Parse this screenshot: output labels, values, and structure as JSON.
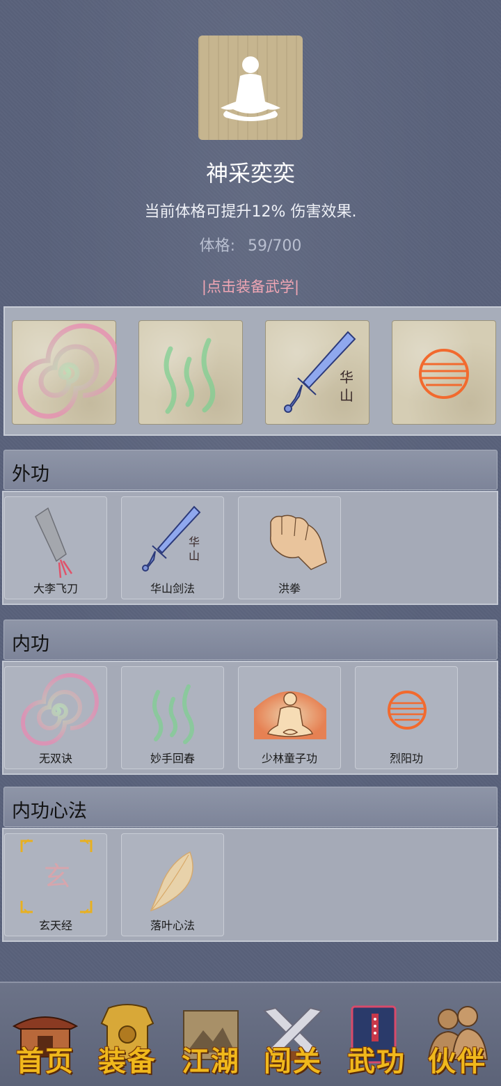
{
  "status": {
    "title": "神采奕奕",
    "description": "当前体格可提升12% 伤害效果.",
    "stat_label": "体格:",
    "stat_value": "59/700",
    "equip_hint": "|点击装备武学|"
  },
  "equipped_slots": [
    {
      "icon": "swirl-icon"
    },
    {
      "icon": "wind-icon"
    },
    {
      "icon": "sword-icon",
      "text": "华山"
    },
    {
      "icon": "fire-orb-icon"
    }
  ],
  "sections": {
    "outer": {
      "title": "外功",
      "items": [
        {
          "label": "大李飞刀",
          "icon": "flying-knife-icon"
        },
        {
          "label": "华山剑法",
          "icon": "sword-icon",
          "glyph": "华山"
        },
        {
          "label": "洪拳",
          "icon": "fist-icon"
        }
      ]
    },
    "inner": {
      "title": "内功",
      "items": [
        {
          "label": "无双诀",
          "icon": "swirl-icon"
        },
        {
          "label": "妙手回春",
          "icon": "wind-icon"
        },
        {
          "label": "少林童子功",
          "icon": "meditating-monk-icon"
        },
        {
          "label": "烈阳功",
          "icon": "fire-orb-icon"
        }
      ]
    },
    "mind": {
      "title": "内功心法",
      "items": [
        {
          "label": "玄天经",
          "icon": "scroll-glyph-icon",
          "glyph": "玄"
        },
        {
          "label": "落叶心法",
          "icon": "leaf-icon"
        }
      ]
    }
  },
  "bottom_nav": [
    {
      "label": "首页",
      "icon": "home-pavilion-icon"
    },
    {
      "label": "装备",
      "icon": "armor-icon"
    },
    {
      "label": "江湖",
      "icon": "map-scroll-icon"
    },
    {
      "label": "闯关",
      "icon": "crossed-swords-icon"
    },
    {
      "label": "武功",
      "icon": "martial-book-icon"
    },
    {
      "label": "伙伴",
      "icon": "companions-icon"
    }
  ],
  "colors": {
    "background": "#59627b",
    "hint": "#f0a6b4",
    "nav_label": "#f0b81c"
  }
}
